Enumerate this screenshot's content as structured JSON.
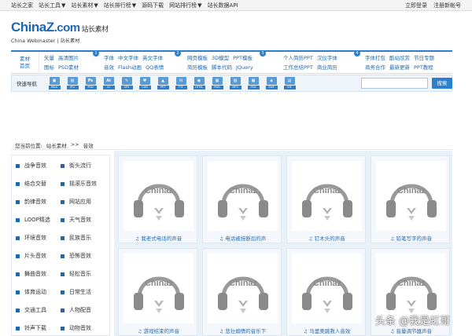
{
  "topbar": {
    "left": [
      "站长之家",
      "站长工具",
      "站长素材",
      "站长排行榜",
      "源码下载",
      "网站排行榜",
      "站长数据API"
    ],
    "right": [
      "立即登录",
      "注册新帐号"
    ]
  },
  "logo": {
    "main_a": "China",
    "main_z": "Z",
    "main_com": ".com",
    "cn": "站长素材",
    "sub": "China Webmaster  |  站长素材"
  },
  "nav": {
    "first": [
      "素材",
      "首页"
    ],
    "groups": [
      {
        "badge": "1",
        "row1": [
          "矢量",
          "高清图片"
        ],
        "row2": [
          "图标",
          "PSD素材"
        ]
      },
      {
        "badge": "2",
        "row1": [
          "字体",
          "中文字体",
          "英文字体"
        ],
        "row2": [
          "音效",
          "Flash动画",
          "QQ表情"
        ]
      },
      {
        "badge": "3",
        "row1": [
          "网页模板",
          "3D模型",
          "PPT模板"
        ],
        "row2": [
          "简历模板",
          "脚本代码",
          "JQuery"
        ]
      },
      {
        "badge": "4",
        "row1": [
          "个人简历PPT",
          "汉仪字体"
        ],
        "row2": [
          "工作总结PPT",
          "商业简历"
        ]
      },
      {
        "badge": "5",
        "row1": [
          "字体打包",
          "酷站欣赏",
          "节日专题"
        ],
        "row2": [
          "商务合作",
          "最新更新",
          "PPT教程"
        ]
      }
    ]
  },
  "quick": {
    "label": "快速导航",
    "icons": [
      {
        "glyph": "▣",
        "tag": "MAX"
      },
      {
        "glyph": "▧",
        "tag": "JPG"
      },
      {
        "glyph": "Ps",
        "tag": "PSD"
      },
      {
        "glyph": "Ai",
        "tag": "AI"
      },
      {
        "glyph": "✎",
        "tag": "EPS"
      },
      {
        "glyph": "♥",
        "tag": "CDR"
      },
      {
        "glyph": "▲",
        "tag": "PPT"
      },
      {
        "glyph": "✉",
        "tag": "TTF"
      },
      {
        "glyph": "◉",
        "tag": "HTML"
      },
      {
        "glyph": "▦",
        "tag": "PNG"
      },
      {
        "glyph": "▨",
        "tag": "MP3"
      },
      {
        "glyph": "▩",
        "tag": "PSD"
      },
      {
        "glyph": "◈",
        "tag": "SWF"
      },
      {
        "glyph": "▤",
        "tag": "GIF"
      }
    ],
    "search_placeholder": "",
    "search_button": "搜索"
  },
  "crumb": [
    "您当前位置:",
    "站长素材",
    ">>",
    "音效"
  ],
  "sidebar": [
    [
      "战争音效",
      "街头流行"
    ],
    [
      "结合交替",
      "摇滚乐音效"
    ],
    [
      "韵律音效",
      "网站应用"
    ],
    [
      "LOOP精选",
      "天气音效"
    ],
    [
      "环境音效",
      "民族音乐"
    ],
    [
      "片头音效",
      "恐怖音效"
    ],
    [
      "舞曲音效",
      "轻松音乐"
    ],
    [
      "体育运动",
      "日常生活"
    ],
    [
      "交通工具",
      "人物配音"
    ],
    [
      "铃声下载",
      "动物音效"
    ]
  ],
  "cards": [
    "我老式电话的声音",
    "电话被挂断后的声",
    "钉木头的声音",
    "铅笔写字的声音",
    "游戏结束的声音",
    "悲壮煽情的音乐下",
    "马里奥跳救人音效",
    "音量调节器声音"
  ],
  "card_logo": "Chinaz",
  "watermark": "头条 @我是虹哥",
  "colors": {
    "accent": "#2b7fcc",
    "link": "#1b68b4",
    "panel": "#e8f0f8"
  }
}
